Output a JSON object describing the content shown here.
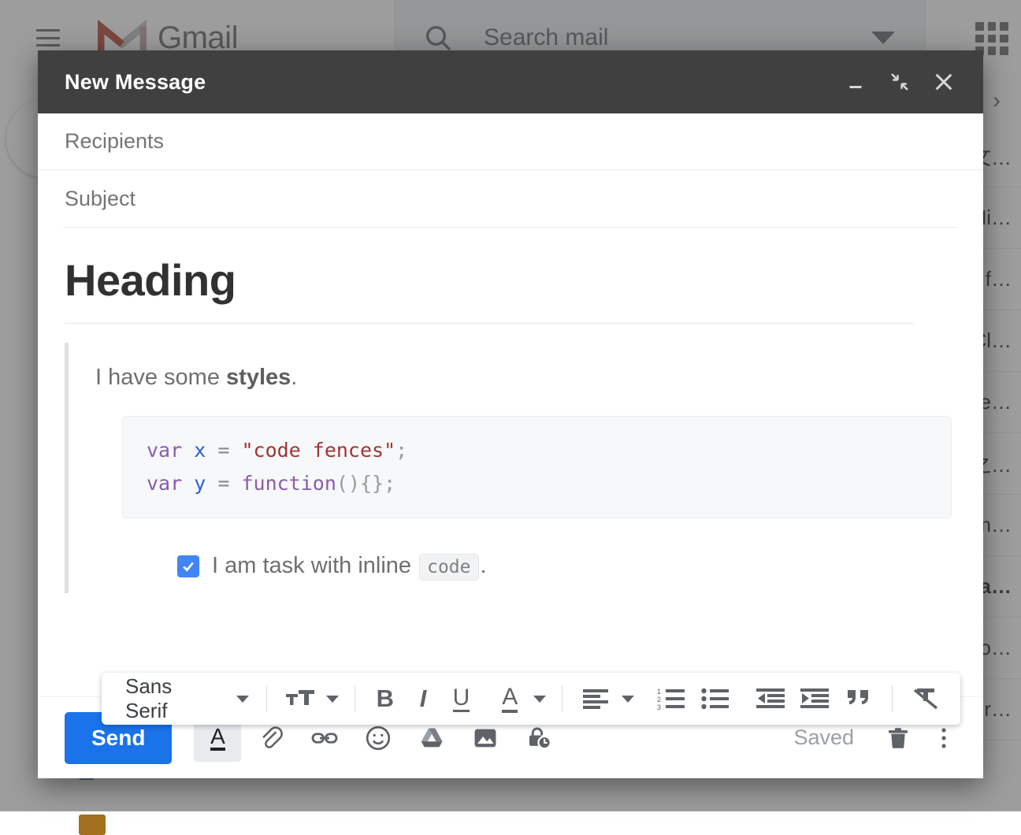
{
  "background_app": {
    "name": "Gmail",
    "hamburger_icon": "hamburger-menu-icon",
    "logo_icon": "gmail-m-logo-icon",
    "logo_text": "Gmail",
    "search": {
      "icon": "search-icon",
      "placeholder": "Search mail",
      "options_icon": "chevron-down-icon"
    },
    "apps_icon": "apps-grid-icon",
    "compose_button_label": "",
    "list_expand_icon": "chevron-right-icon",
    "email_rows": [
      {
        "snippet": "文…",
        "bold": false
      },
      {
        "snippet": "Hi…",
        "bold": false
      },
      {
        "snippet": "n f…",
        "bold": false
      },
      {
        "snippet": "Cl…",
        "bold": false
      },
      {
        "snippet": "te…",
        "bold": false
      },
      {
        "snippet": "之…",
        "bold": false
      },
      {
        "snippet": "m…",
        "bold": false
      },
      {
        "snippet": "la…",
        "bold": true
      },
      {
        "snippet": "o…",
        "bold": false
      },
      {
        "snippet": "ur…",
        "bold": false
      }
    ]
  },
  "compose": {
    "title": "New Message",
    "window_buttons": [
      {
        "name": "minimize-button",
        "icon": "minimize-icon"
      },
      {
        "name": "exit-full-screen-button",
        "icon": "exit-full-screen-icon"
      },
      {
        "name": "close-button",
        "icon": "close-icon"
      }
    ],
    "recipients_placeholder": "Recipients",
    "recipients_value": "",
    "subject_placeholder": "Subject",
    "subject_value": "",
    "body": {
      "heading": "Heading",
      "quote_text_plain": "I have some ",
      "quote_text_bold": "styles",
      "quote_text_end": ".",
      "code_block": {
        "language": "javascript",
        "line1": {
          "kw": "var",
          "var": "x",
          "op": "=",
          "str": "\"code fences\"",
          "end": ";"
        },
        "line2": {
          "kw": "var",
          "var": "y",
          "op": "=",
          "fn": "function",
          "pun": "(){}",
          "end": ";"
        }
      },
      "task": {
        "checked": true,
        "text_before": "I am task with inline ",
        "inline_code": "code",
        "text_after": "."
      }
    },
    "format_toolbar": {
      "font_name": "Sans Serif",
      "font_caret_icon": "chevron-down-icon",
      "buttons": [
        {
          "name": "font-size-button",
          "icon": "font-size-icon",
          "label": "TT"
        },
        {
          "name": "font-size-caret",
          "icon": "chevron-down-icon"
        },
        {
          "name": "bold-button",
          "icon": "bold-icon",
          "label": "B"
        },
        {
          "name": "italic-button",
          "icon": "italic-icon",
          "label": "I"
        },
        {
          "name": "underline-button",
          "icon": "underline-icon",
          "label": "U"
        },
        {
          "name": "text-color-button",
          "icon": "text-color-icon",
          "label": "A"
        },
        {
          "name": "text-color-caret",
          "icon": "chevron-down-icon"
        },
        {
          "name": "align-button",
          "icon": "align-left-icon"
        },
        {
          "name": "align-caret",
          "icon": "chevron-down-icon"
        },
        {
          "name": "numbered-list-button",
          "icon": "numbered-list-icon"
        },
        {
          "name": "bulleted-list-button",
          "icon": "bulleted-list-icon"
        },
        {
          "name": "decrease-indent-button",
          "icon": "decrease-indent-icon"
        },
        {
          "name": "increase-indent-button",
          "icon": "increase-indent-icon"
        },
        {
          "name": "quote-button",
          "icon": "quote-icon"
        },
        {
          "name": "remove-formatting-button",
          "icon": "remove-formatting-icon"
        }
      ]
    },
    "actions": {
      "send_label": "Send",
      "buttons": [
        {
          "name": "formatting-options-button",
          "icon": "formatting-options-icon",
          "active": true
        },
        {
          "name": "attach-file-button",
          "icon": "paperclip-icon",
          "active": false
        },
        {
          "name": "insert-link-button",
          "icon": "link-icon",
          "active": false
        },
        {
          "name": "insert-emoji-button",
          "icon": "emoji-icon",
          "active": false
        },
        {
          "name": "insert-drive-file-button",
          "icon": "google-drive-icon",
          "active": false
        },
        {
          "name": "insert-photo-button",
          "icon": "photo-icon",
          "active": false
        },
        {
          "name": "confidential-mode-button",
          "icon": "lock-clock-icon",
          "active": false
        }
      ],
      "status": "Saved",
      "discard_icon": "trash-icon",
      "more_options_icon": "more-vertical-icon"
    }
  },
  "colors": {
    "accent_blue": "#1a73e8",
    "checkbox_blue": "#4285f4",
    "titlebar_gray": "#404040",
    "code_keyword": "#8a5bad",
    "code_variable": "#2a5fd9",
    "code_string": "#a03535",
    "text_gray": "#6f6f6f"
  }
}
